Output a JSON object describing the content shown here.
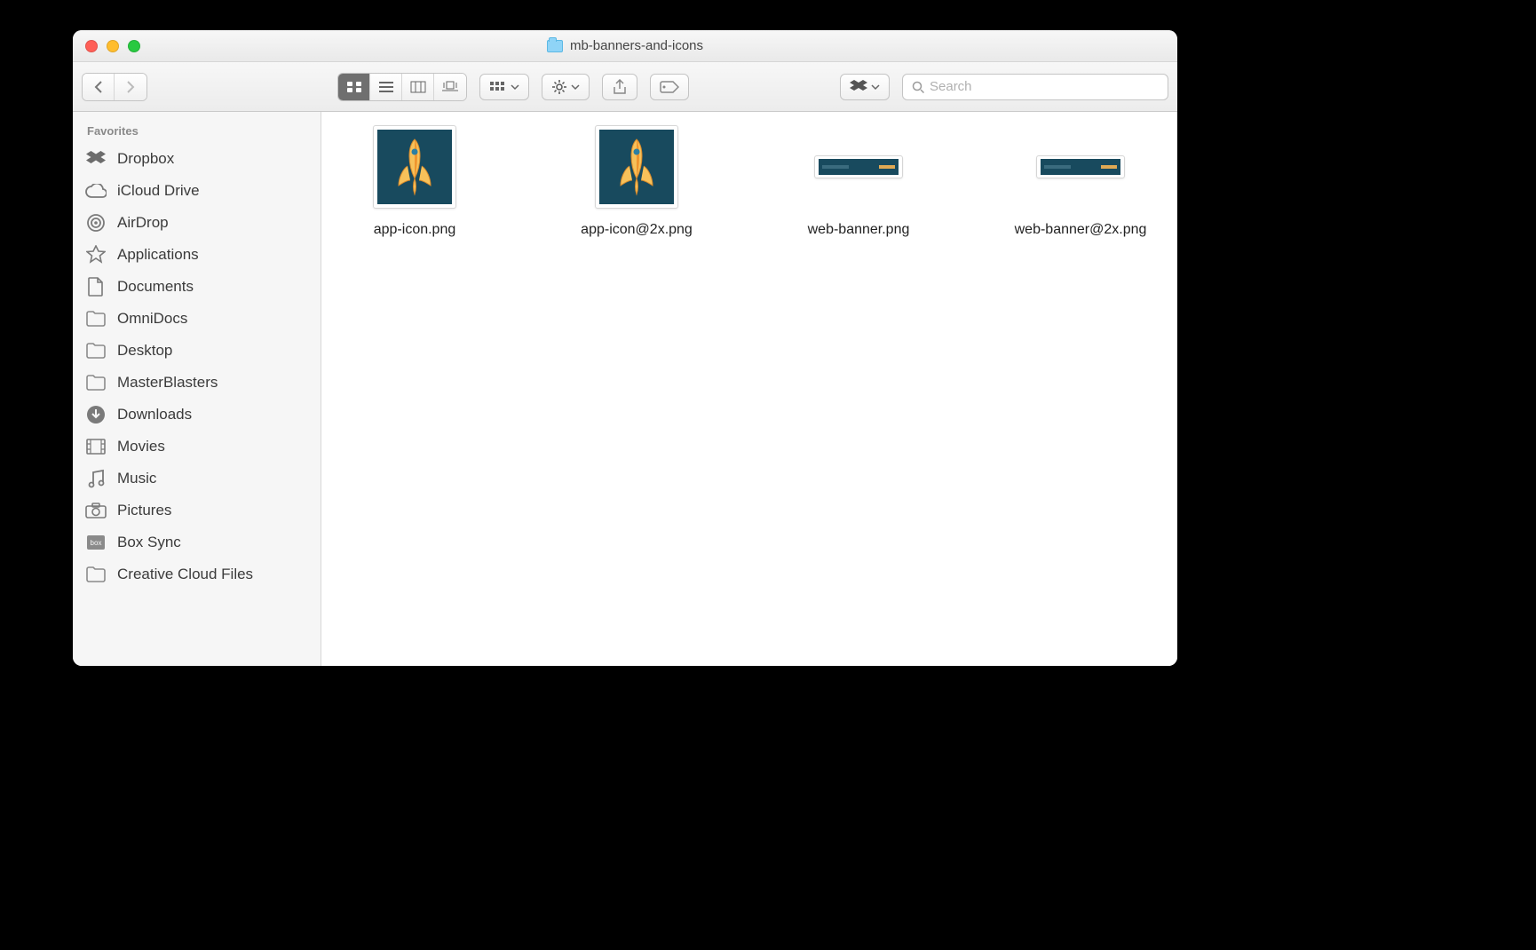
{
  "window": {
    "title": "mb-banners-and-icons"
  },
  "toolbar": {
    "search_placeholder": "Search"
  },
  "sidebar": {
    "section": "Favorites",
    "items": [
      {
        "icon": "dropbox",
        "label": "Dropbox"
      },
      {
        "icon": "icloud",
        "label": "iCloud Drive"
      },
      {
        "icon": "airdrop",
        "label": "AirDrop"
      },
      {
        "icon": "apps",
        "label": "Applications"
      },
      {
        "icon": "doc",
        "label": "Documents"
      },
      {
        "icon": "folder",
        "label": "OmniDocs"
      },
      {
        "icon": "desktop",
        "label": "Desktop"
      },
      {
        "icon": "folder",
        "label": "MasterBlasters"
      },
      {
        "icon": "download",
        "label": "Downloads"
      },
      {
        "icon": "movies",
        "label": "Movies"
      },
      {
        "icon": "music",
        "label": "Music"
      },
      {
        "icon": "pictures",
        "label": "Pictures"
      },
      {
        "icon": "box",
        "label": "Box Sync"
      },
      {
        "icon": "folder",
        "label": "Creative Cloud Files"
      }
    ]
  },
  "files": [
    {
      "name": "app-icon.png",
      "kind": "square"
    },
    {
      "name": "app-icon@2x.png",
      "kind": "square"
    },
    {
      "name": "web-banner.png",
      "kind": "banner"
    },
    {
      "name": "web-banner@2x.png",
      "kind": "banner"
    }
  ]
}
